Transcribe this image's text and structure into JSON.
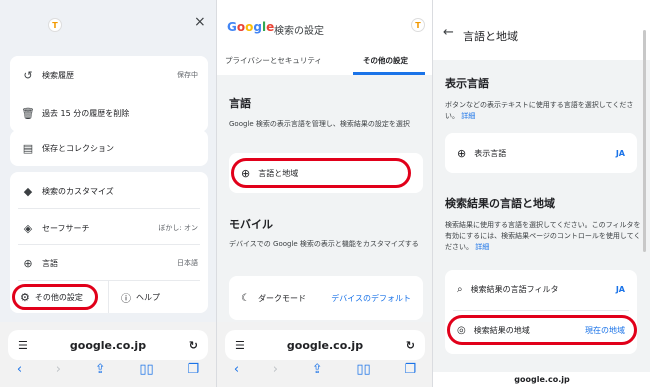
{
  "panel1": {
    "close_icon": "×",
    "menu": [
      {
        "icon": "history-icon",
        "glyph": "↺",
        "label": "検索履歴",
        "value": "保存中"
      },
      {
        "icon": "delete-history-icon",
        "glyph": "🗑",
        "label": "過去 15 分の履歴を削除",
        "value": ""
      },
      {
        "icon": "collection-icon",
        "glyph": "▤",
        "label": "保存とコレクション",
        "value": ""
      },
      {
        "icon": "customize-icon",
        "glyph": "◆",
        "label": "検索のカスタマイズ",
        "value": ""
      },
      {
        "icon": "safesearch-icon",
        "glyph": "◈",
        "label": "セーフサーチ",
        "value": "ぼかし: オン"
      },
      {
        "icon": "language-icon",
        "glyph": "⊕",
        "label": "言語",
        "value": "日本語"
      }
    ],
    "other_settings": "その他の設定",
    "help": "ヘルプ",
    "url": "google.co.jp"
  },
  "panel2": {
    "logo": "Google",
    "title": "検索の設定",
    "tabs": [
      "プライバシーとセキュリティ",
      "その他の設定"
    ],
    "section1_title": "言語",
    "section1_desc": "Google 検索の表示言語を管理し、検索結果の設定を選択",
    "lang_region": "言語と地域",
    "section2_title": "モバイル",
    "section2_desc": "デバイスでの Google 検索の表示と機能をカスタマイズする",
    "dark_mode": "ダークモード",
    "dark_mode_value": "デバイスのデフォルト",
    "url": "google.co.jp"
  },
  "panel3": {
    "title": "言語と地域",
    "display_lang_title": "表示言語",
    "display_lang_desc": "ボタンなどの表示テキストに使用する言語を選択してください。",
    "details1": "詳細",
    "display_lang_label": "表示言語",
    "display_lang_value": "JA",
    "results_title": "検索結果の言語と地域",
    "results_desc": "検索結果に使用する言語を選択してください。このフィルタを有効にするには、検索結果ページのコントロールを使用してください。",
    "details2": "詳細",
    "lang_filter": "検索結果の言語フィルタ",
    "lang_filter_value": "JA",
    "region": "検索結果の地域",
    "region_value": "現在の地域",
    "url": "google.co.jp"
  },
  "colors": {
    "accent": "#1a73e8",
    "highlight": "#e1001a"
  }
}
